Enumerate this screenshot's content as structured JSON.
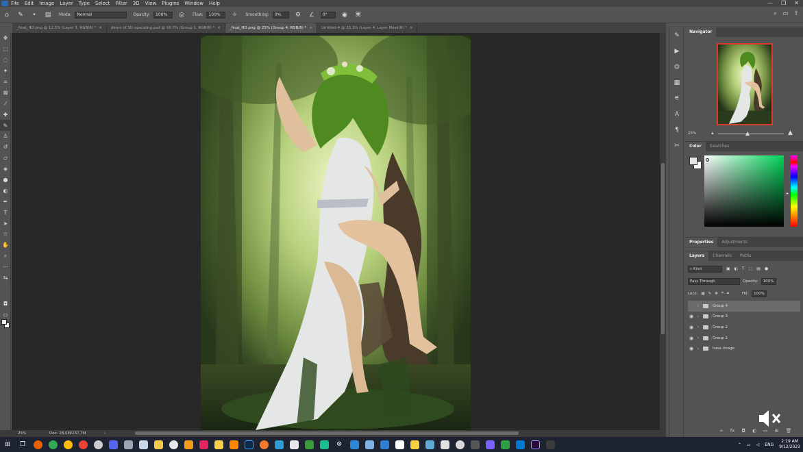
{
  "menu": {
    "items": [
      "File",
      "Edit",
      "Image",
      "Layer",
      "Type",
      "Select",
      "Filter",
      "3D",
      "View",
      "Plugins",
      "Window",
      "Help"
    ],
    "window_controls": [
      "—",
      "❐",
      "✕"
    ]
  },
  "options": {
    "mode_label": "Mode:",
    "mode_value": "Normal",
    "opacity_label": "Opacity:",
    "opacity_value": "100%",
    "flow_label": "Flow:",
    "flow_value": "100%",
    "smoothing_label": "Smoothing:",
    "smoothing_value": "0%",
    "angle_value": "0°"
  },
  "tabs": [
    {
      "label": "_final_HD.png @ 12.5% (Layer 1, RGB/8) *",
      "active": false
    },
    {
      "label": "demo of SD upscaling.psd @ 16.7% (Group 1, RGB/8) *",
      "active": false
    },
    {
      "label": "_final_HD.png @ 25% (Group 4, RGB/8) *",
      "active": true
    },
    {
      "label": "Untitled-4 @ 33.3% (Layer 4, Layer Mask/8) *",
      "active": false
    }
  ],
  "status": {
    "zoom": "25%",
    "doc": "Doc: 28.0M/237.7M"
  },
  "navigator": {
    "tab": "Navigator",
    "zoom": "25%"
  },
  "color": {
    "tabs": [
      "Color",
      "Swatches"
    ],
    "foreground": "#e6e6e6",
    "hue_color": "#00d458"
  },
  "properties": {
    "tabs": [
      "Properties",
      "Adjustments"
    ]
  },
  "layers_panel": {
    "tabs": [
      "Layers",
      "Channels",
      "Paths"
    ],
    "kind_label": "Kind",
    "blend_mode": "Pass Through",
    "opacity_label": "Opacity:",
    "opacity_value": "100%",
    "lock_label": "Lock:",
    "fill_label": "Fill:",
    "fill_value": "100%",
    "layers": [
      {
        "name": "Group 4",
        "visible": false,
        "selected": true
      },
      {
        "name": "Group 3",
        "visible": true,
        "selected": false
      },
      {
        "name": "Group 2",
        "visible": true,
        "selected": false
      },
      {
        "name": "Group 1",
        "visible": true,
        "selected": false
      },
      {
        "name": "base image",
        "visible": true,
        "selected": false
      }
    ]
  },
  "taskbar": {
    "time": "2:19 AM",
    "date": "9/12/2023",
    "language": "ENG"
  },
  "colors": {
    "accent_border": "#d83b2a",
    "tab_active": "#535353",
    "panel_bg": "#535353",
    "canvas_bg": "#282828"
  }
}
